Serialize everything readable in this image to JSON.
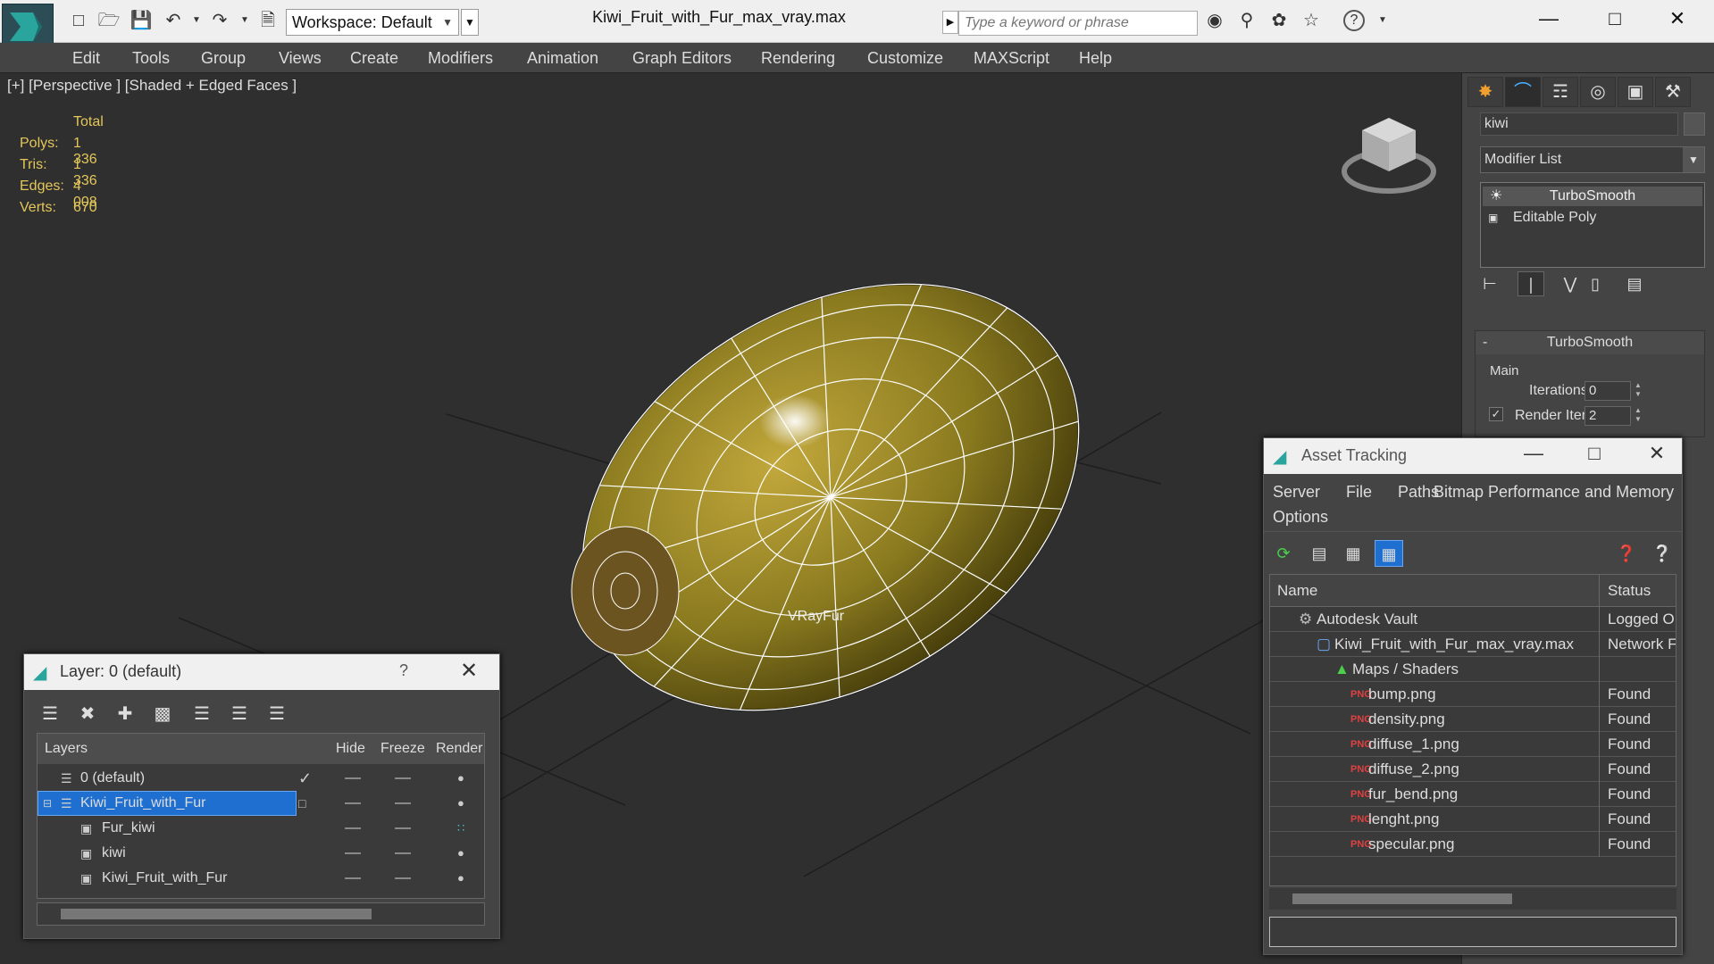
{
  "titlebar": {
    "workspace": "Workspace: Default",
    "file_title": "Kiwi_Fruit_with_Fur_max_vray.max",
    "search_placeholder": "Type a keyword or phrase",
    "help_glyph": "?"
  },
  "menu": [
    "Edit",
    "Tools",
    "Group",
    "Views",
    "Create",
    "Modifiers",
    "Animation",
    "Graph Editors",
    "Rendering",
    "Customize",
    "MAXScript",
    "Help"
  ],
  "viewport": {
    "label": "[+] [Perspective ] [Shaded + Edged Faces ]",
    "stats_header": "Total",
    "stats": [
      {
        "label": "Polys:",
        "value": "1 336"
      },
      {
        "label": "Tris:",
        "value": "1 336"
      },
      {
        "label": "Edges:",
        "value": "4 008"
      },
      {
        "label": "Verts:",
        "value": "670"
      }
    ],
    "object_label": "VRayFur"
  },
  "command_panel": {
    "object_name": "kiwi",
    "modifier_list": "Modifier List",
    "stack": [
      "TurboSmooth",
      "Editable Poly"
    ],
    "rollout_title": "TurboSmooth",
    "rollout_minus": "-",
    "group_main": "Main",
    "iterations_label": "Iterations:",
    "iterations_value": "0",
    "render_iters_label": "Render Iters:",
    "render_iters_value": "2",
    "render_iters_checked": true
  },
  "layer_dialog": {
    "title": "Layer: 0 (default)",
    "help": "?",
    "columns": [
      "Layers",
      "Hide",
      "Freeze",
      "Render"
    ],
    "rows": [
      {
        "name": "0 (default)",
        "level": 0,
        "current": true
      },
      {
        "name": "Kiwi_Fruit_with_Fur",
        "level": 0,
        "selected": true
      },
      {
        "name": "Fur_kiwi",
        "level": 1
      },
      {
        "name": "kiwi",
        "level": 1
      },
      {
        "name": "Kiwi_Fruit_with_Fur",
        "level": 1
      }
    ]
  },
  "asset_tracking": {
    "title": "Asset Tracking",
    "menu": [
      "Server",
      "File",
      "Paths",
      "Bitmap Performance and Memory",
      "Options"
    ],
    "columns": [
      "Name",
      "Status"
    ],
    "rows": [
      {
        "name": "Autodesk Vault",
        "status": "Logged O",
        "level": 1
      },
      {
        "name": "Kiwi_Fruit_with_Fur_max_vray.max",
        "status": "Network F",
        "level": 2
      },
      {
        "name": "Maps / Shaders",
        "status": "",
        "level": 3
      },
      {
        "name": "bump.png",
        "status": "Found",
        "level": 4
      },
      {
        "name": "density.png",
        "status": "Found",
        "level": 4
      },
      {
        "name": "diffuse_1.png",
        "status": "Found",
        "level": 4
      },
      {
        "name": "diffuse_2.png",
        "status": "Found",
        "level": 4
      },
      {
        "name": "fur_bend.png",
        "status": "Found",
        "level": 4
      },
      {
        "name": "lenght.png",
        "status": "Found",
        "level": 4
      },
      {
        "name": "specular.png",
        "status": "Found",
        "level": 4
      }
    ],
    "png_badge": "PNG"
  },
  "colors": {
    "accent": "#1f6fd1",
    "stats_text": "#e4c75a",
    "kiwi_skin": "#8a7a1f"
  }
}
